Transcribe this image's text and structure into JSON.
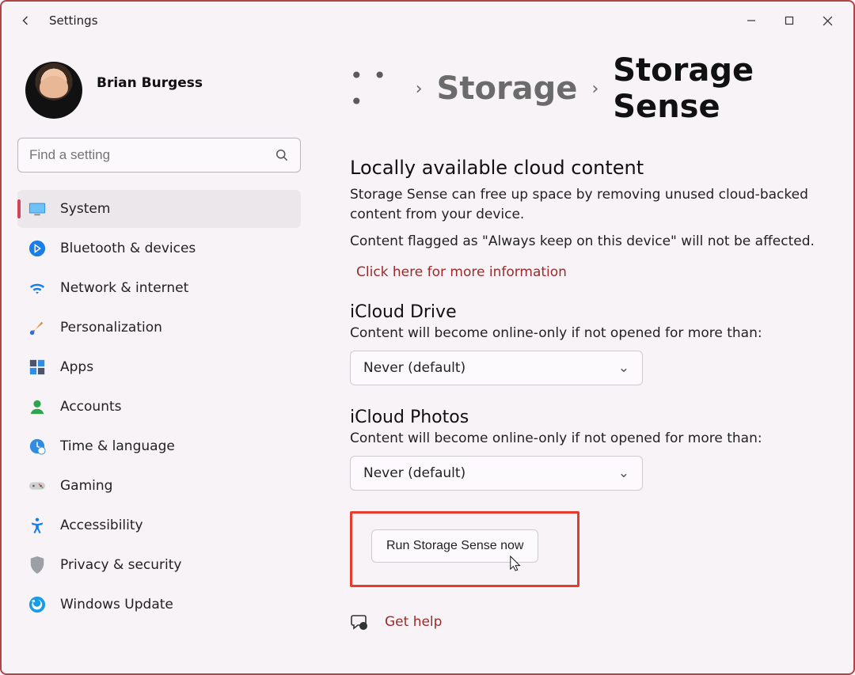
{
  "app": {
    "title": "Settings"
  },
  "profile": {
    "name": "Brian Burgess"
  },
  "search": {
    "placeholder": "Find a setting"
  },
  "nav": {
    "items": [
      {
        "label": "System",
        "icon": "monitor",
        "active": true
      },
      {
        "label": "Bluetooth & devices",
        "icon": "bluetooth"
      },
      {
        "label": "Network & internet",
        "icon": "wifi"
      },
      {
        "label": "Personalization",
        "icon": "brush"
      },
      {
        "label": "Apps",
        "icon": "apps"
      },
      {
        "label": "Accounts",
        "icon": "person"
      },
      {
        "label": "Time & language",
        "icon": "clock-globe"
      },
      {
        "label": "Gaming",
        "icon": "gamepad"
      },
      {
        "label": "Accessibility",
        "icon": "accessibility"
      },
      {
        "label": "Privacy & security",
        "icon": "shield"
      },
      {
        "label": "Windows Update",
        "icon": "update"
      }
    ]
  },
  "breadcrumb": {
    "ellipsis": "• • •",
    "parent": "Storage",
    "current": "Storage Sense"
  },
  "cloud": {
    "heading": "Locally available cloud content",
    "p1": "Storage Sense can free up space by removing unused cloud-backed content from your device.",
    "p2": "Content flagged as \"Always keep on this device\" will not be affected.",
    "more_link": "Click here for more information"
  },
  "icloud_drive": {
    "heading": "iCloud Drive",
    "sub": "Content will become online-only if not opened for more than:",
    "selected": "Never (default)"
  },
  "icloud_photos": {
    "heading": "iCloud Photos",
    "sub": "Content will become online-only if not opened for more than:",
    "selected": "Never (default)"
  },
  "run_button": "Run Storage Sense now",
  "help_link": "Get help"
}
